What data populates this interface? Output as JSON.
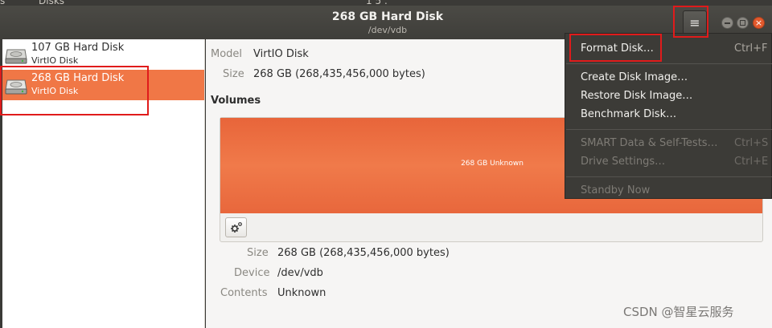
{
  "window": {
    "title": "268 GB Hard Disk",
    "subtitle": "/dev/vdb",
    "top_fragments": [
      "s",
      "Disks",
      "1 5 :"
    ]
  },
  "sidebar": {
    "items": [
      {
        "name": "107 GB Hard Disk",
        "model": "VirtIO Disk",
        "selected": false
      },
      {
        "name": "268 GB Hard Disk",
        "model": "VirtIO Disk",
        "selected": true
      }
    ]
  },
  "drive_info": {
    "model_key": "Model",
    "model_value": "VirtIO Disk",
    "size_key": "Size",
    "size_value": "268 GB (268,435,456,000 bytes)"
  },
  "volumes": {
    "heading": "Volumes",
    "bar_label": "268 GB Unknown",
    "details": [
      {
        "key": "Size",
        "value": "268 GB (268,435,456,000 bytes)"
      },
      {
        "key": "Device",
        "value": "/dev/vdb"
      },
      {
        "key": "Contents",
        "value": "Unknown"
      }
    ]
  },
  "menu": {
    "items": [
      {
        "label": "Format Disk…",
        "accel": "Ctrl+F",
        "disabled": false
      },
      {
        "label": "Create Disk Image…",
        "accel": "",
        "disabled": false
      },
      {
        "label": "Restore Disk Image…",
        "accel": "",
        "disabled": false
      },
      {
        "label": "Benchmark Disk…",
        "accel": "",
        "disabled": false
      },
      {
        "label": "SMART Data & Self-Tests…",
        "accel": "Ctrl+S",
        "disabled": true
      },
      {
        "label": "Drive Settings…",
        "accel": "Ctrl+E",
        "disabled": true
      },
      {
        "label": "Standby Now",
        "accel": "",
        "disabled": true
      }
    ]
  },
  "watermark": "CSDN @智星云服务",
  "colors": {
    "accent": "#f07746",
    "volume_bar": "#ed6f41",
    "menu_bg": "#3c3b37",
    "highlight_box": "#e01b1b",
    "close_button": "#e2592c"
  },
  "icons": {
    "menu_button": "hamburger-icon",
    "disk": "hard-disk-icon",
    "volume_options": "gear-icon"
  }
}
